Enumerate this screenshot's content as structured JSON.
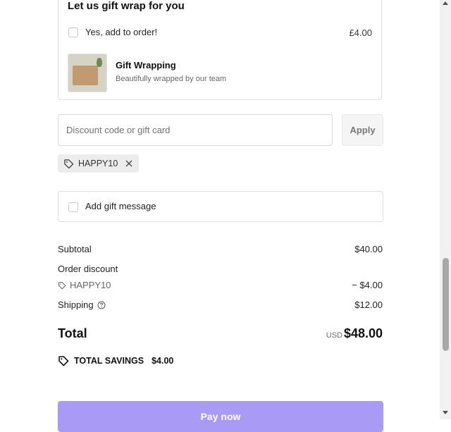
{
  "gift_wrap": {
    "title": "Let us gift wrap for you",
    "checkbox_label": "Yes, add to order!",
    "price": "£4.00",
    "item_name": "Gift Wrapping",
    "item_desc": "Beautifully wrapped by our team",
    "thumbnail_icon": "gift-box-photo"
  },
  "discount": {
    "placeholder": "Discount code or gift card",
    "apply_label": "Apply",
    "applied_code": "HAPPY10",
    "tag_icon": "tag-icon",
    "remove_icon": "close-icon"
  },
  "gift_message": {
    "label": "Add gift message"
  },
  "summary": {
    "subtotal_label": "Subtotal",
    "subtotal_value": "$40.00",
    "order_discount_label": "Order discount",
    "discount_code": "HAPPY10",
    "discount_value": "− $4.00",
    "shipping_label": "Shipping",
    "shipping_value": "$12.00",
    "total_label": "Total",
    "currency": "USD",
    "total_value": "$48.00",
    "savings_label": "TOTAL SAVINGS",
    "savings_value": "$4.00"
  },
  "pay_button": {
    "label": "Pay now",
    "color": "#a99af5"
  }
}
